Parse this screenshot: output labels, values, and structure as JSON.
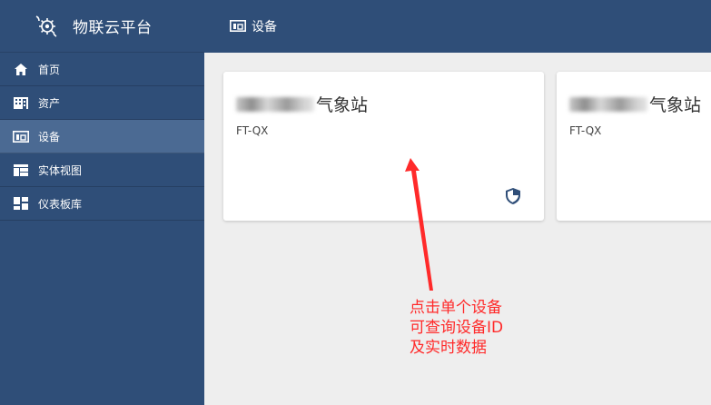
{
  "brand": {
    "title": "物联云平台",
    "logo_icon": "gear-flask-logo-icon"
  },
  "sidebar": {
    "items": [
      {
        "label": "首页",
        "icon": "home-icon",
        "active": false
      },
      {
        "label": "资产",
        "icon": "building-icon",
        "active": false
      },
      {
        "label": "设备",
        "icon": "device-icon",
        "active": true
      },
      {
        "label": "实体视图",
        "icon": "entity-view-icon",
        "active": false
      },
      {
        "label": "仪表板库",
        "icon": "dashboard-icon",
        "active": false
      }
    ]
  },
  "header": {
    "title": "设备",
    "icon": "device-icon"
  },
  "devices": [
    {
      "name_suffix": "气象站",
      "type": "FT-QX",
      "icon": "shield-icon"
    },
    {
      "name_suffix": "气象站",
      "type": "FT-QX"
    }
  ],
  "annotation": {
    "lines": [
      "点击单个设备",
      "可查询设备ID",
      "及实时数据"
    ],
    "color": "#ff2a2a"
  },
  "colors": {
    "sidebar_bg": "#2f4e78",
    "sidebar_active": "#4b6a93",
    "main_bg": "#eeeeee"
  }
}
